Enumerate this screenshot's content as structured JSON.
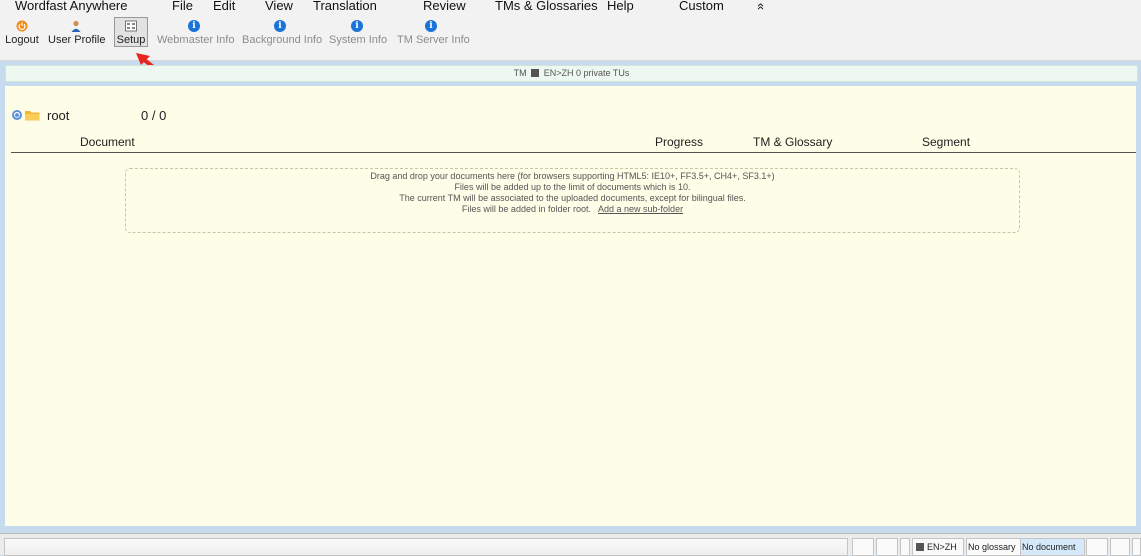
{
  "menu": {
    "items": [
      "Wordfast Anywhere",
      "File",
      "Edit",
      "View",
      "Translation",
      "Review",
      "TMs & Glossaries",
      "Help",
      "Custom",
      "«"
    ]
  },
  "toolbar": {
    "logout": "Logout",
    "user_profile": "User Profile",
    "setup": "Setup",
    "webmaster_info": "Webmaster Info",
    "background_info": "Background Info",
    "system_info": "System Info",
    "tm_server_info": "TM Server Info",
    "info_glyph": "i"
  },
  "tm_bar": {
    "prefix": "TM",
    "text": "EN>ZH 0 private TUs"
  },
  "folder": {
    "name": "root",
    "count": "0 / 0"
  },
  "table": {
    "headers": [
      "Document",
      "Progress",
      "TM & Glossary",
      "Segment"
    ]
  },
  "drop_zone": {
    "line1": "Drag and drop your documents here (for browsers supporting HTML5: IE10+, FF3.5+, CH4+, SF3.1+)",
    "line2": "Files will be added up to the limit of documents which is 10.",
    "line3": "The current TM will be associated to the uploaded documents, except for bilingual files.",
    "line4": "Files will be added in folder root.",
    "link": "Add a new sub-folder"
  },
  "status": {
    "lang_pair": "EN>ZH",
    "glossary": "No glossary",
    "document": "No document"
  },
  "colors": {
    "accent_blue": "#1a73d8",
    "arrow_red": "#e8261e",
    "main_bg": "#fdfde8"
  }
}
